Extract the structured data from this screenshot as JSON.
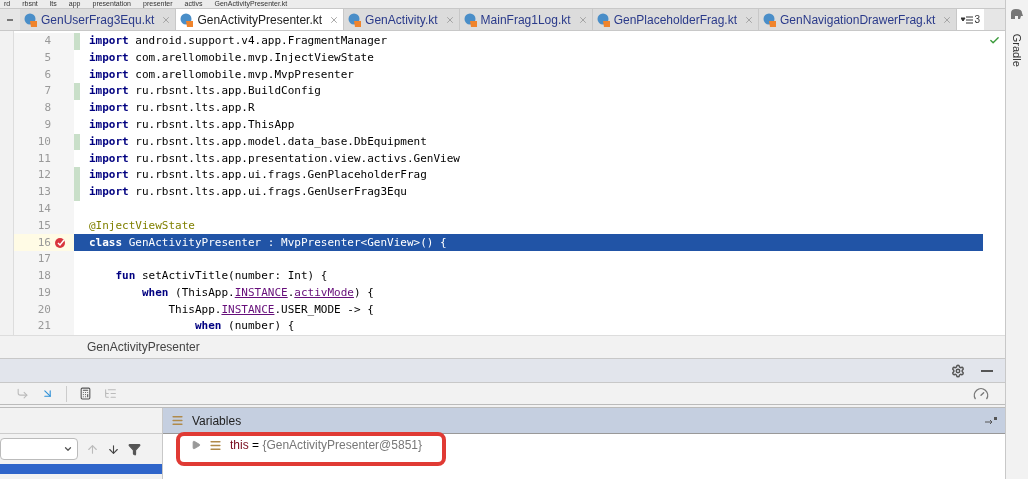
{
  "breadcrumbs": [
    "rd",
    "rbsnt",
    "lts",
    "app",
    "presentation",
    "presenter",
    "activs",
    "GenActivityPresenter.kt"
  ],
  "tabs": [
    {
      "label": "GenUserFrag3Equ.kt",
      "selected": false
    },
    {
      "label": "GenActivityPresenter.kt",
      "selected": true
    },
    {
      "label": "GenActivity.kt",
      "selected": false
    },
    {
      "label": "MainFrag1Log.kt",
      "selected": false
    },
    {
      "label": "GenPlaceholderFrag.kt",
      "selected": false
    },
    {
      "label": "GenNavigationDrawerFrag.kt",
      "selected": false
    }
  ],
  "tab_overflow": "3",
  "editor": {
    "lines": [
      {
        "number": "4",
        "changed": true,
        "selected": false,
        "tokens": [
          {
            "kind": "keyword",
            "text": "import"
          },
          {
            "kind": "plain",
            "text": " android.support.v4.app.FragmentManager"
          }
        ]
      },
      {
        "number": "5",
        "changed": false,
        "selected": false,
        "tokens": [
          {
            "kind": "keyword",
            "text": "import"
          },
          {
            "kind": "plain",
            "text": " com.arellomobile.mvp.InjectViewState"
          }
        ]
      },
      {
        "number": "6",
        "changed": false,
        "selected": false,
        "tokens": [
          {
            "kind": "keyword",
            "text": "import"
          },
          {
            "kind": "plain",
            "text": " com.arellomobile.mvp.MvpPresenter"
          }
        ]
      },
      {
        "number": "7",
        "changed": true,
        "selected": false,
        "tokens": [
          {
            "kind": "keyword",
            "text": "import"
          },
          {
            "kind": "plain",
            "text": " ru.rbsnt.lts.app.BuildConfig"
          }
        ]
      },
      {
        "number": "8",
        "changed": false,
        "selected": false,
        "tokens": [
          {
            "kind": "keyword",
            "text": "import"
          },
          {
            "kind": "plain",
            "text": " ru.rbsnt.lts.app.R"
          }
        ]
      },
      {
        "number": "9",
        "changed": false,
        "selected": false,
        "tokens": [
          {
            "kind": "keyword",
            "text": "import"
          },
          {
            "kind": "plain",
            "text": " ru.rbsnt.lts.app.ThisApp"
          }
        ]
      },
      {
        "number": "10",
        "changed": true,
        "selected": false,
        "tokens": [
          {
            "kind": "keyword",
            "text": "import"
          },
          {
            "kind": "plain",
            "text": " ru.rbsnt.lts.app.model.data_base.DbEquipment"
          }
        ]
      },
      {
        "number": "11",
        "changed": false,
        "selected": false,
        "tokens": [
          {
            "kind": "keyword",
            "text": "import"
          },
          {
            "kind": "plain",
            "text": " ru.rbsnt.lts.app.presentation.view.activs.GenView"
          }
        ]
      },
      {
        "number": "12",
        "changed": true,
        "selected": false,
        "tokens": [
          {
            "kind": "keyword",
            "text": "import"
          },
          {
            "kind": "plain",
            "text": " ru.rbsnt.lts.app.ui.frags.GenPlaceholderFrag"
          }
        ]
      },
      {
        "number": "13",
        "changed": true,
        "selected": false,
        "tokens": [
          {
            "kind": "keyword",
            "text": "import"
          },
          {
            "kind": "plain",
            "text": " ru.rbsnt.lts.app.ui.frags.GenUserFrag3Equ"
          }
        ]
      },
      {
        "number": "14",
        "changed": false,
        "selected": false
      },
      {
        "number": "15",
        "changed": false,
        "selected": false,
        "tokens": [
          {
            "kind": "annotation",
            "text": "@InjectViewState"
          }
        ]
      },
      {
        "number": "16",
        "changed": false,
        "selected": true,
        "breakpoint": true,
        "tokens": [
          {
            "kind": "keyword",
            "text": "class"
          },
          {
            "kind": "plain",
            "text": " GenActivityPresenter : MvpPresenter<GenView>() {"
          }
        ]
      },
      {
        "number": "17",
        "changed": false,
        "selected": false
      },
      {
        "number": "18",
        "changed": false,
        "selected": false,
        "tokens": [
          {
            "kind": "keyword",
            "text": "    fun"
          },
          {
            "kind": "plain",
            "text": " setActivTitle(number: Int) {"
          }
        ]
      },
      {
        "number": "19",
        "changed": false,
        "selected": false,
        "tokens": [
          {
            "kind": "keyword",
            "text": "        when"
          },
          {
            "kind": "plain",
            "text": " (ThisApp."
          },
          {
            "kind": "field",
            "text": "INSTANCE"
          },
          {
            "kind": "plain",
            "text": "."
          },
          {
            "kind": "field",
            "text": "activMode"
          },
          {
            "kind": "plain",
            "text": ") {"
          }
        ]
      },
      {
        "number": "20",
        "changed": false,
        "selected": false,
        "tokens": [
          {
            "kind": "plain",
            "text": "            ThisApp."
          },
          {
            "kind": "field",
            "text": "INSTANCE"
          },
          {
            "kind": "plain",
            "text": ".USER_MODE -> {"
          }
        ]
      },
      {
        "number": "21",
        "changed": false,
        "selected": false,
        "tokens": [
          {
            "kind": "keyword",
            "text": "                when"
          },
          {
            "kind": "plain",
            "text": " (number) {"
          }
        ]
      }
    ]
  },
  "editor_breadcrumb": "GenActivityPresenter",
  "right_sidebar": {
    "label": "Gradle"
  },
  "variables": {
    "title": "Variables",
    "items": [
      {
        "name": "this",
        "separator": "=",
        "value": "{GenActivityPresenter@5851}",
        "expanded": false
      }
    ]
  }
}
